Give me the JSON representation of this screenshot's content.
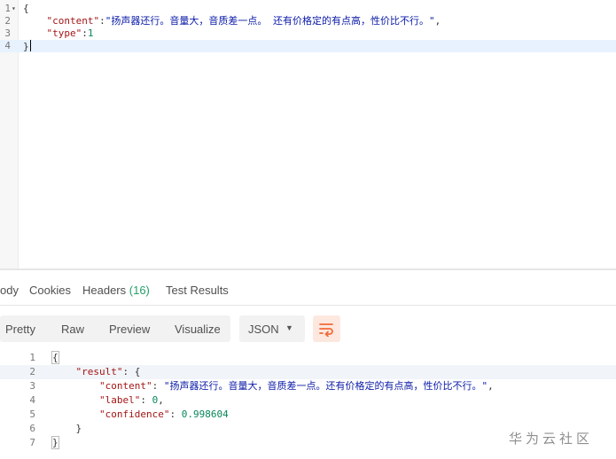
{
  "request": {
    "lines": [
      {
        "num": "1",
        "text": "{"
      },
      {
        "num": "2",
        "key": "\"content\"",
        "sep": ":",
        "value": "\"扬声器还行。音量大，音质差一点。 还有价格定的有点高，性价比不行。\"",
        "tail": ","
      },
      {
        "num": "3",
        "key": "\"type\"",
        "sep": ":",
        "value": "1"
      },
      {
        "num": "4",
        "text": "}"
      }
    ]
  },
  "response_tabs": {
    "body": "ody",
    "cookies": "Cookies",
    "headers": "Headers",
    "headers_count": "(16)",
    "test_results": "Test Results"
  },
  "format_bar": {
    "pretty": "Pretty",
    "raw": "Raw",
    "preview": "Preview",
    "visualize": "Visualize",
    "language": "JSON",
    "wrap_icon": "wrap-lines-icon"
  },
  "response": {
    "lines": [
      {
        "num": "1",
        "text": "{"
      },
      {
        "num": "2",
        "key": "\"result\"",
        "text": ": {"
      },
      {
        "num": "3",
        "key": "\"content\"",
        "sep": ": ",
        "value": "\"扬声器还行。音量大，音质差一点。还有价格定的有点高，性价比不行。\"",
        "tail": ","
      },
      {
        "num": "4",
        "key": "\"label\"",
        "sep": ": ",
        "value": "0",
        "tail": ","
      },
      {
        "num": "5",
        "key": "\"confidence\"",
        "sep": ": ",
        "value": "0.998604"
      },
      {
        "num": "6",
        "text": "}"
      },
      {
        "num": "7",
        "text": "}"
      }
    ]
  },
  "watermark": "华为云社区",
  "colors": {
    "key": "#a31515",
    "string": "#0b1ba8",
    "number": "#098658",
    "count_green": "#26a06a",
    "wrap_button_bg": "#fde8e0",
    "wrap_icon": "#f26b3a"
  }
}
